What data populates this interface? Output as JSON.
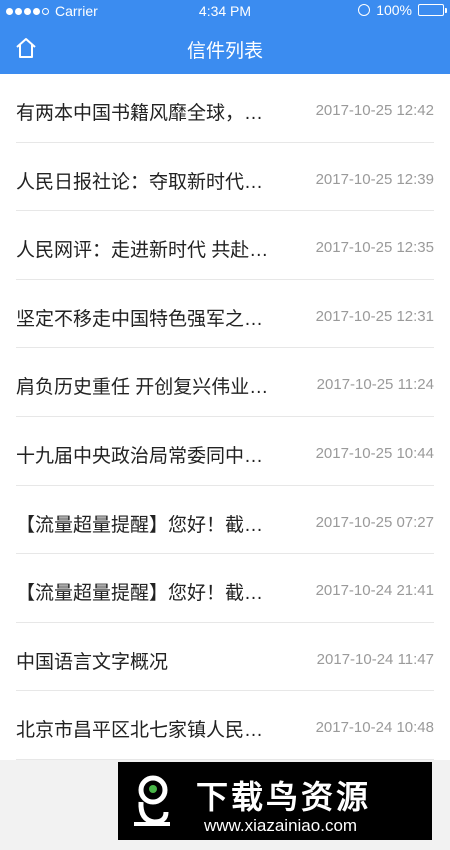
{
  "status_bar": {
    "carrier": "Carrier",
    "time": "4:34 PM",
    "battery": "100%",
    "battery_level": 1.0
  },
  "navbar": {
    "title": "信件列表",
    "home_icon": "home-icon"
  },
  "letters": [
    {
      "title": "有两本中国书籍风靡全球，…",
      "date": "2017-10-25 12:42"
    },
    {
      "title": "人民日报社论：夺取新时代…",
      "date": "2017-10-25 12:39"
    },
    {
      "title": "人民网评：走进新时代 共赴…",
      "date": "2017-10-25 12:35"
    },
    {
      "title": "坚定不移走中国特色强军之…",
      "date": "2017-10-25 12:31"
    },
    {
      "title": "肩负历史重任 开创复兴伟业…",
      "date": "2017-10-25 11:24"
    },
    {
      "title": "十九届中央政治局常委同中…",
      "date": "2017-10-25 10:44"
    },
    {
      "title": "【流量超量提醒】您好！截…",
      "date": "2017-10-25 07:27"
    },
    {
      "title": "【流量超量提醒】您好！截…",
      "date": "2017-10-24 21:41"
    },
    {
      "title": "中国语言文字概况",
      "date": "2017-10-24 11:47"
    },
    {
      "title": "北京市昌平区北七家镇人民…",
      "date": "2017-10-24 10:48"
    }
  ],
  "watermark": {
    "name": "下载鸟资源",
    "url": "www.xiazainiao.com"
  },
  "colors": {
    "accent": "#3b8cf0",
    "date_text": "#9a9a9a",
    "title_text": "#222222"
  }
}
